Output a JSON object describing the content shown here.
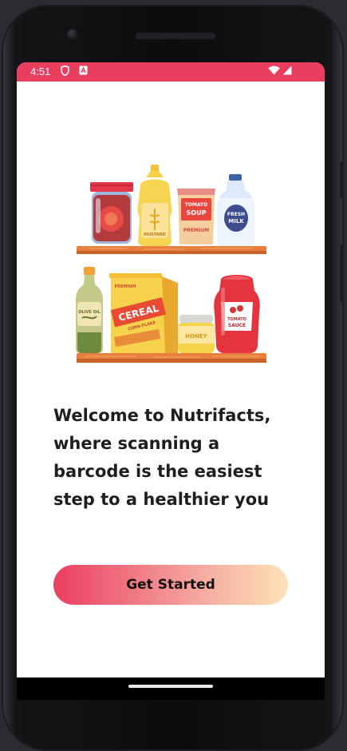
{
  "status_bar": {
    "time": "4:51",
    "color": "#ea3e5f",
    "left_icons": [
      "shield-icon",
      "a-icon"
    ],
    "right_icons": [
      "wifi-icon",
      "signal-icon"
    ]
  },
  "illustration": {
    "top_shelf": {
      "jar_label": "",
      "mustard_label": "MUSTARD",
      "soup_label_1": "TOMATO",
      "soup_label_2": "SOUP",
      "soup_label_3": "PREMIUM",
      "milk_label_1": "FRESH",
      "milk_label_2": "MILK"
    },
    "bottom_shelf": {
      "oil_label": "OLIVE OIL",
      "cereal_tag": "PREMIUM",
      "cereal_label": "CEREAL",
      "cereal_sub": "CORN FLAKE",
      "honey_label": "HONEY",
      "sauce_label_1": "TOMATO",
      "sauce_label_2": "SAUCE"
    }
  },
  "welcome": {
    "lines": [
      "Welcome to Nutrifacts,",
      "where scanning a",
      "barcode is the easiest",
      "step to a healthier you"
    ]
  },
  "cta": {
    "label": "Get Started",
    "gradient": [
      "#ea3e5f",
      "#fde3b6"
    ]
  }
}
